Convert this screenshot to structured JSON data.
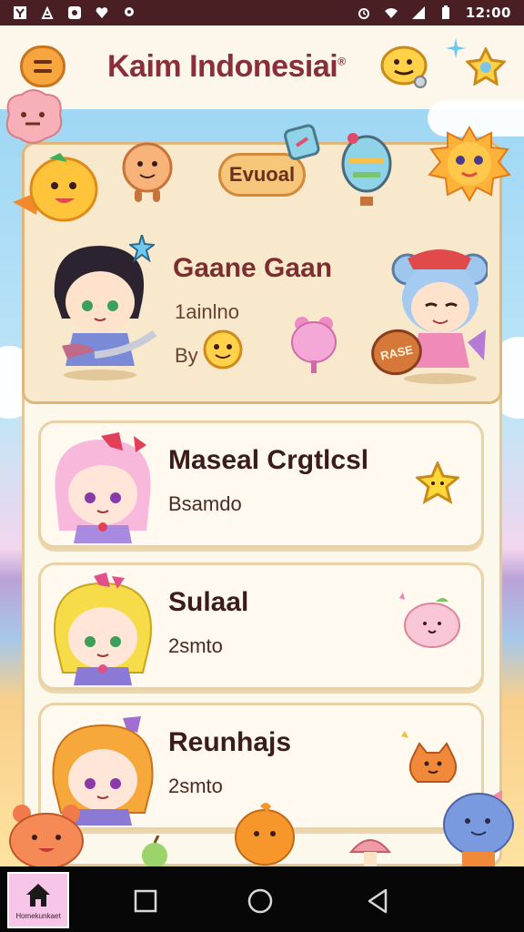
{
  "status_bar": {
    "time": "12:00",
    "left_icons": [
      "notification-icon",
      "pin-icon",
      "app-icon",
      "heart-icon",
      "location-icon"
    ],
    "right_icons": [
      "alarm-icon",
      "wifi-icon",
      "signal-icon",
      "battery-icon"
    ]
  },
  "header": {
    "title": "Kaim Indonesiai",
    "trademark": "®"
  },
  "featured": {
    "event_label": "Evuoal",
    "title": "Gaane Gaan",
    "subtitle": "1ainlno",
    "by_label": "By",
    "badge_text": "RASE"
  },
  "list": [
    {
      "title": "Maseal Crgtlcsl",
      "subtitle": "Bsamdo"
    },
    {
      "title": "Sulaal",
      "subtitle": "2smto"
    },
    {
      "title": "Reunhajs",
      "subtitle": "2smto"
    }
  ],
  "nav": {
    "home_label": "Homekunkaet",
    "buttons": [
      "recents-button",
      "home-button",
      "back-button"
    ]
  },
  "colors": {
    "accent": "#f6a63c",
    "title": "#8a2f3a",
    "status_bar": "#4a1f24"
  }
}
